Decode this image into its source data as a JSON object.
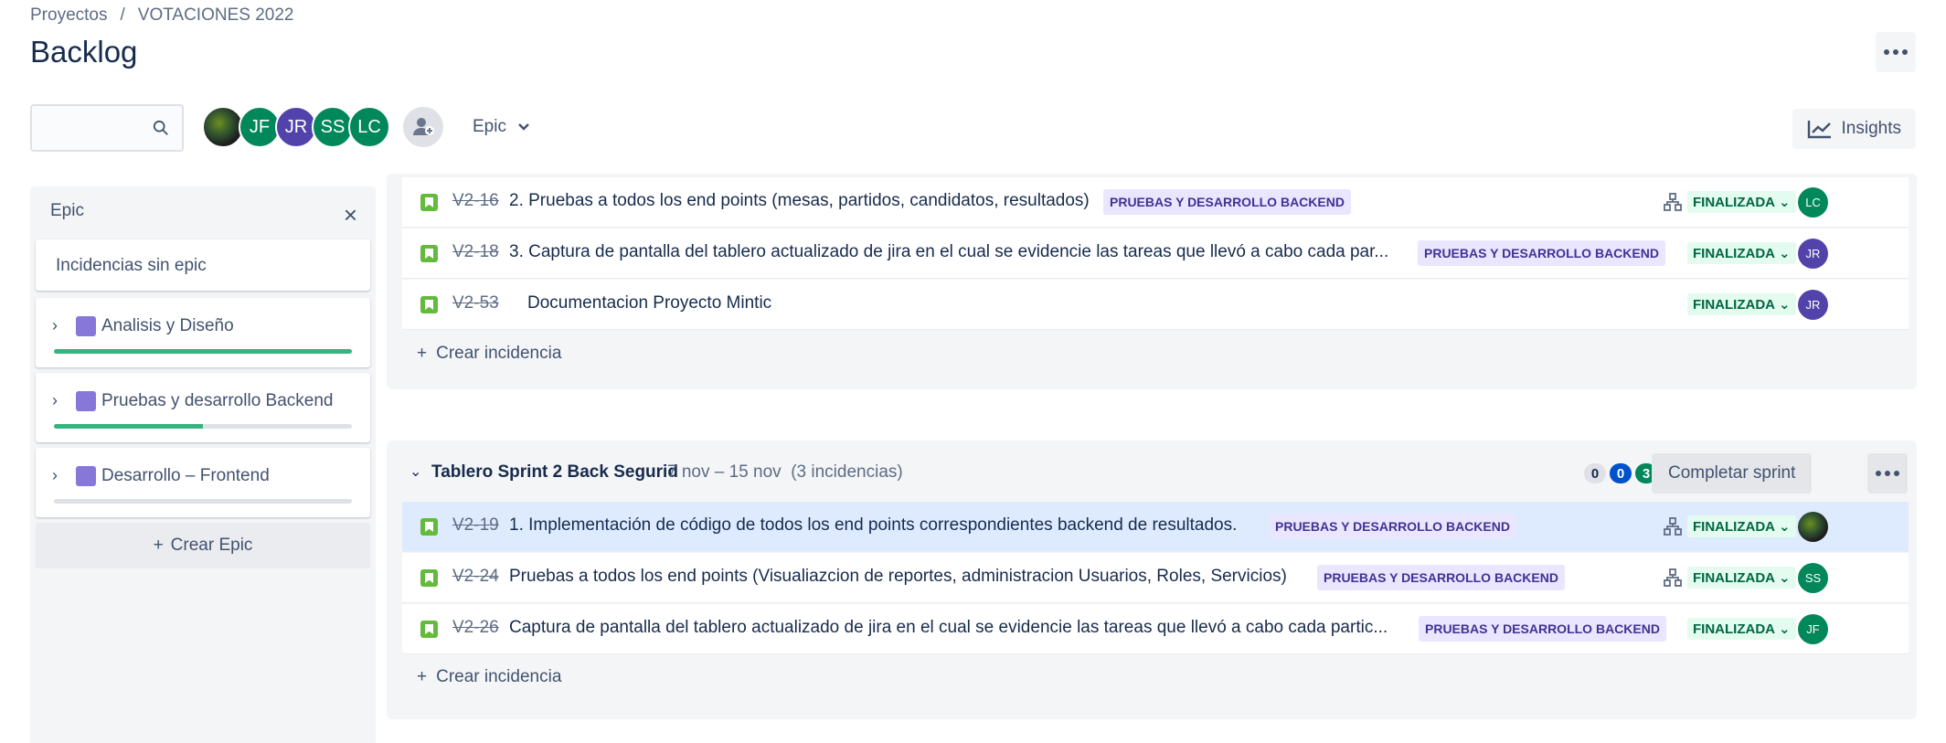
{
  "breadcrumb": {
    "projects": "Proyectos",
    "separator": "/",
    "project": "VOTACIONES 2022"
  },
  "page_title": "Backlog",
  "toolbar": {
    "search_placeholder": "",
    "avatars": [
      "",
      "JF",
      "JR",
      "SS",
      "LC"
    ],
    "epic_filter": "Epic",
    "insights": "Insights"
  },
  "epic_panel": {
    "title": "Epic",
    "no_epic": "Incidencias sin epic",
    "epics": [
      {
        "name": "Analisis y Diseño",
        "progress": 1.0
      },
      {
        "name": "Pruebas y desarrollo Backend",
        "progress": 0.5
      },
      {
        "name": "Desarrollo – Frontend",
        "progress": 0.0
      }
    ],
    "create": "Crear Epic"
  },
  "sprint1": {
    "issues": [
      {
        "key": "V2-16",
        "summary": "2. Pruebas a todos los end points (mesas, partidos, candidatos, resultados)",
        "epic": "PRUEBAS Y DESARROLLO BACKEND",
        "status": "FINALIZADA",
        "assignee": "LC",
        "has_child": true
      },
      {
        "key": "V2-18",
        "summary": "3. Captura de pantalla del tablero actualizado de jira en el cual se evidencie las tareas que llevó a cabo cada par...",
        "epic": "PRUEBAS Y DESARROLLO BACKEND",
        "status": "FINALIZADA",
        "assignee": "JR",
        "has_child": false
      },
      {
        "key": "V2-53",
        "summary": "Documentacion Proyecto Mintic",
        "epic": "",
        "status": "FINALIZADA",
        "assignee": "JR",
        "has_child": false
      }
    ],
    "create_issue": "Crear incidencia"
  },
  "sprint2": {
    "name": "Tablero Sprint 2 Back Segurid",
    "dates": "7 nov – 15 nov",
    "count_text": "(3 incidencias)",
    "counts": {
      "todo": "0",
      "in_progress": "0",
      "done": "3"
    },
    "complete": "Completar sprint",
    "issues": [
      {
        "key": "V2-19",
        "summary": "1. Implementación de código de todos los end points correspondientes backend de resultados.",
        "epic": "PRUEBAS Y DESARROLLO BACKEND",
        "status": "FINALIZADA",
        "assignee": "",
        "has_child": true
      },
      {
        "key": "V2-24",
        "summary": "Pruebas a todos los end points (Visualiazcion de reportes, administracion Usuarios, Roles, Servicios)",
        "epic": "PRUEBAS Y DESARROLLO BACKEND",
        "status": "FINALIZADA",
        "assignee": "SS",
        "has_child": true
      },
      {
        "key": "V2-26",
        "summary": "Captura de pantalla del tablero actualizado de jira en el cual se evidencie las tareas que llevó a cabo cada partic...",
        "epic": "PRUEBAS Y DESARROLLO BACKEND",
        "status": "FINALIZADA",
        "assignee": "JF",
        "has_child": false
      }
    ],
    "create_issue": "Crear incidencia"
  },
  "colors": {
    "accent": "#0052cc",
    "done": "#00875a",
    "epic": "#8777d9",
    "lozenge_bg": "#eae6ff",
    "lozenge_fg": "#403294"
  }
}
